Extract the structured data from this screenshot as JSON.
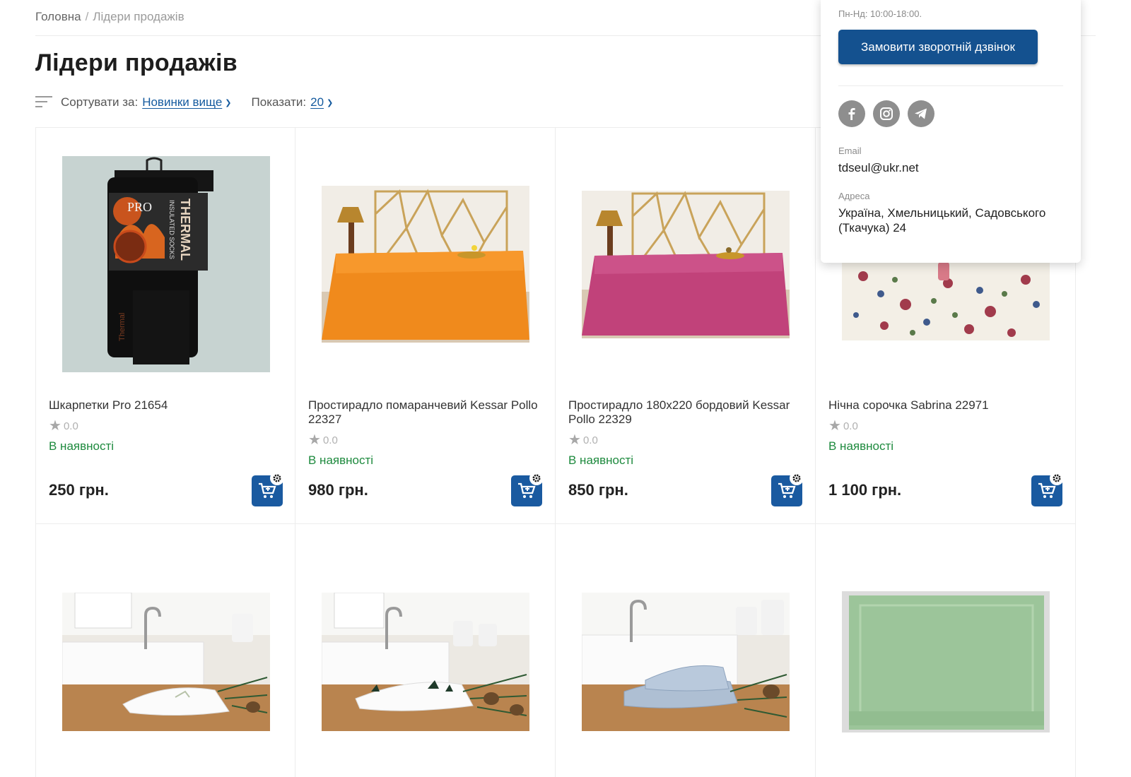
{
  "breadcrumb": {
    "home": "Головна",
    "separator": "/",
    "current": "Лідери продажів"
  },
  "page_title": "Лідери продажів",
  "toolbar": {
    "sort_label": "Сортувати за:",
    "sort_value": "Новинки вище",
    "show_label": "Показати:",
    "show_value": "20"
  },
  "products": [
    {
      "name": "Шкарпетки Pro 21654",
      "rating": "0.0",
      "stock": "В наявності",
      "price": "250 грн."
    },
    {
      "name": "Простирадло помаранчевий Kessar Pollo 22327",
      "rating": "0.0",
      "stock": "В наявності",
      "price": "980 грн."
    },
    {
      "name": "Простирадло 180х220 бордовий Kessar Pollo 22329",
      "rating": "0.0",
      "stock": "В наявності",
      "price": "850 грн."
    },
    {
      "name": "Нічна сорочка Sabrina 22971",
      "rating": "0.0",
      "stock": "В наявності",
      "price": "1 100 грн."
    }
  ],
  "contact_popup": {
    "hours": "Пн-Нд: 10:00-18:00.",
    "callback_button": "Замовити зворотній дзвінок",
    "social": [
      "facebook-icon",
      "instagram-icon",
      "telegram-icon"
    ],
    "email_label": "Email",
    "email": "tdseul@ukr.net",
    "address_label": "Адреса",
    "address": "Україна, Хмельницький, Садовського (Ткачука) 24"
  },
  "colors": {
    "accent": "#1a5aa0",
    "in_stock": "#1e8a3e",
    "link": "#145a9e"
  }
}
